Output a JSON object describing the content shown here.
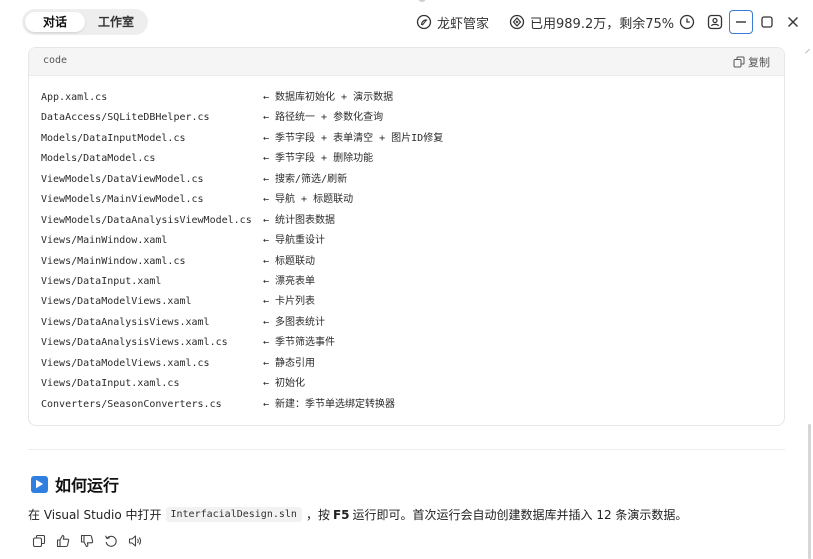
{
  "header": {
    "tabs": [
      {
        "label": "对话",
        "active": true
      },
      {
        "label": "工作室",
        "active": false
      }
    ],
    "shrimp_label": "龙虾管家",
    "quota_label": "已用989.2万，剩余75%"
  },
  "code_block": {
    "language": "code",
    "copy_label": "复制",
    "lines": [
      {
        "file": "App.xaml.cs",
        "comment": "← 数据库初始化 + 演示数据"
      },
      {
        "file": "DataAccess/SQLiteDBHelper.cs",
        "comment": "← 路径统一 + 参数化查询"
      },
      {
        "file": "Models/DataInputModel.cs",
        "comment": " ← 季节字段 + 表单清空 + 图片ID修复"
      },
      {
        "file": "Models/DataModel.cs",
        "comment": "← 季节字段 + 删除功能"
      },
      {
        "file": "ViewModels/DataViewModel.cs",
        "comment": "← 搜索/筛选/刷新"
      },
      {
        "file": "ViewModels/MainViewModel.cs",
        "comment": " ← 导航 + 标题联动"
      },
      {
        "file": "ViewModels/DataAnalysisViewModel.cs",
        "comment": " ← 统计图表数据"
      },
      {
        "file": "Views/MainWindow.xaml",
        "comment": " ← 导航重设计"
      },
      {
        "file": "Views/MainWindow.xaml.cs",
        "comment": " ← 标题联动"
      },
      {
        "file": "Views/DataInput.xaml",
        "comment": "← 漂亮表单"
      },
      {
        "file": "Views/DataModelViews.xaml",
        "comment": "← 卡片列表"
      },
      {
        "file": "Views/DataAnalysisViews.xaml",
        "comment": " ← 多图表统计"
      },
      {
        "file": "Views/DataAnalysisViews.xaml.cs",
        "comment": "← 季节筛选事件"
      },
      {
        "file": "Views/DataModelViews.xaml.cs",
        "comment": "← 静态引用"
      },
      {
        "file": "Views/DataInput.xaml.cs",
        "comment": "← 初始化"
      },
      {
        "file": "Converters/SeasonConverters.cs",
        "comment": " ← 新建：季节单选绑定转换器"
      }
    ]
  },
  "run_section": {
    "title": "如何运行",
    "desc_prefix": "在 Visual Studio 中打开",
    "solution_file": "InterfacialDesign.sln",
    "desc_mid": "，按",
    "key": "F5",
    "desc_suffix": "运行即可。首次运行会自动创建数据库并插入 12 条演示数据。"
  },
  "colors": {
    "accent": "#2f7fe0",
    "min_button_border": "#3a7bd5"
  },
  "icons": [
    "shrimp-icon",
    "quota-icon",
    "history-icon",
    "user-icon",
    "minimize-icon",
    "maximize-icon",
    "close-icon",
    "copy-icon",
    "play-icon",
    "copy-action-icon",
    "thumbs-up-icon",
    "thumbs-down-icon",
    "retry-icon",
    "speaker-icon"
  ]
}
